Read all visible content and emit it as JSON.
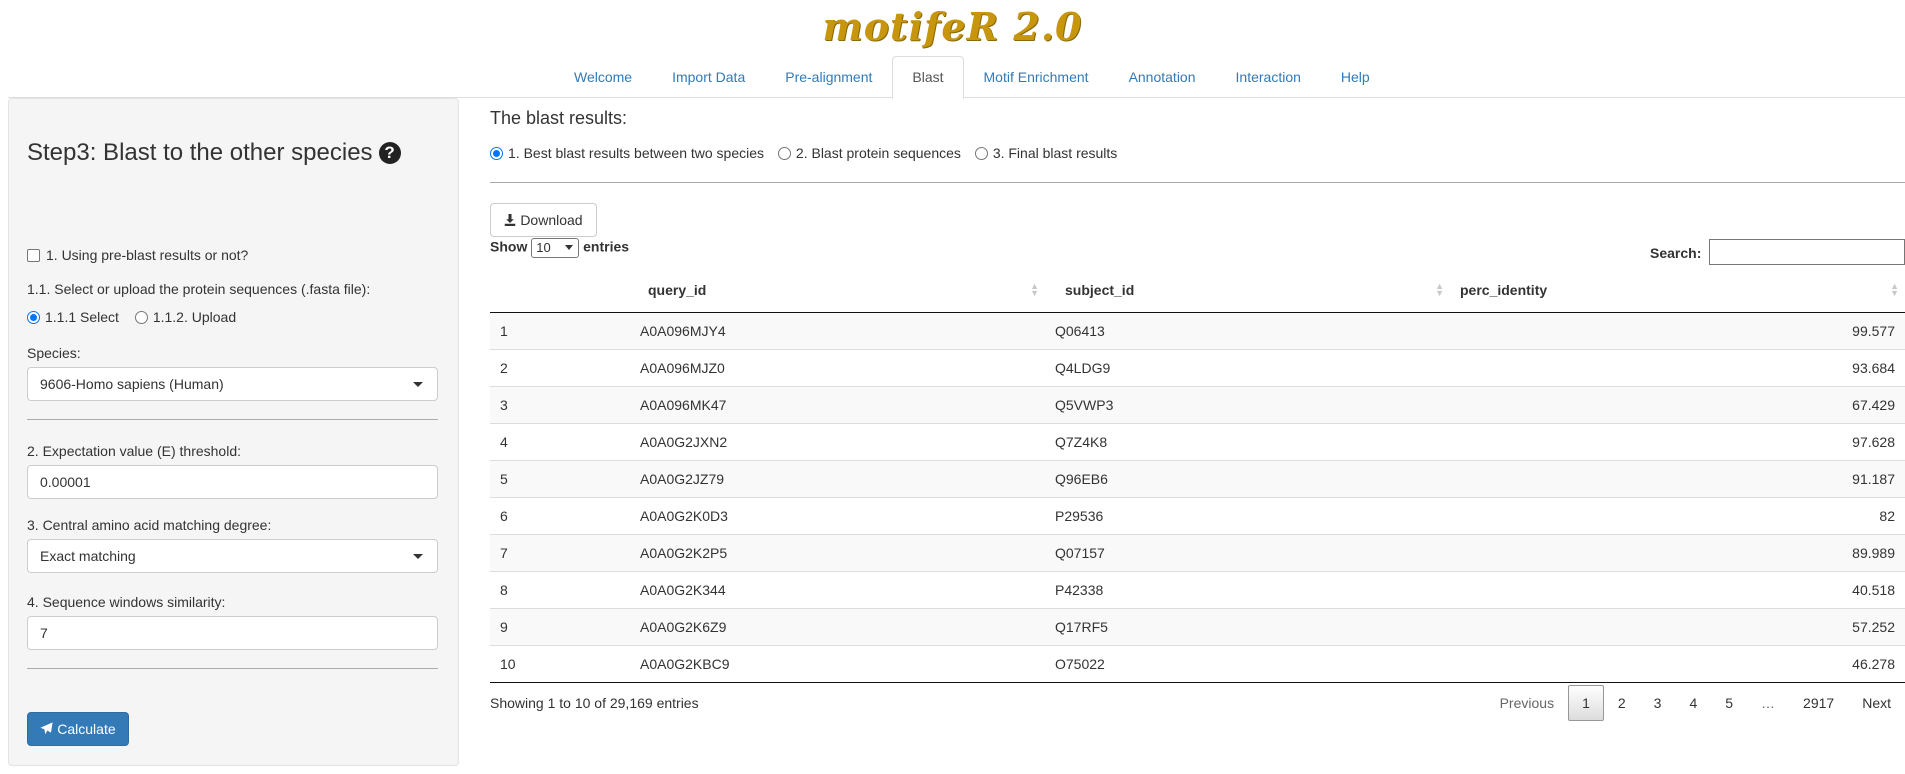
{
  "app": {
    "brand": "motifeR 2.0"
  },
  "nav": {
    "tabs": [
      "Welcome",
      "Import Data",
      "Pre-alignment",
      "Blast",
      "Motif Enrichment",
      "Annotation",
      "Interaction",
      "Help"
    ],
    "active": "Blast"
  },
  "sidebar": {
    "title": "Step3: Blast to the other species",
    "help_icon": "question-circle-icon",
    "preblast_label": "1. Using pre-blast results or not?",
    "preblast_checked": false,
    "select_upload_label": "1.1. Select or upload the protein sequences (.fasta file):",
    "option_select": "1.1.1 Select",
    "option_upload": "1.1.2. Upload",
    "species_label": "Species:",
    "species_value": "9606-Homo sapiens (Human)",
    "evalue_label": "2. Expectation value (E) threshold:",
    "evalue_value": "0.00001",
    "central_label": "3. Central amino acid matching degree:",
    "central_value": "Exact matching",
    "window_label": "4. Sequence windows similarity:",
    "window_value": "7",
    "calculate_label": "Calculate",
    "calculate_icon": "paper-plane-icon"
  },
  "main": {
    "results_title": "The blast results:",
    "result_options": [
      "1. Best blast results between two species",
      "2. Blast protein sequences",
      "3. Final blast results"
    ],
    "selected_option": 0,
    "download_label": "Download",
    "download_icon": "download-icon",
    "show_label": "Show",
    "length_value": "10",
    "entries_label": "entries",
    "search_label": "Search:",
    "table": {
      "columns": [
        "",
        "query_id",
        "subject_id",
        "perc_identity"
      ],
      "rows": [
        [
          "1",
          "A0A096MJY4",
          "Q06413",
          "99.577"
        ],
        [
          "2",
          "A0A096MJZ0",
          "Q4LDG9",
          "93.684"
        ],
        [
          "3",
          "A0A096MK47",
          "Q5VWP3",
          "67.429"
        ],
        [
          "4",
          "A0A0G2JXN2",
          "Q7Z4K8",
          "97.628"
        ],
        [
          "5",
          "A0A0G2JZ79",
          "Q96EB6",
          "91.187"
        ],
        [
          "6",
          "A0A0G2K0D3",
          "P29536",
          "82"
        ],
        [
          "7",
          "A0A0G2K2P5",
          "Q07157",
          "89.989"
        ],
        [
          "8",
          "A0A0G2K344",
          "P42338",
          "40.518"
        ],
        [
          "9",
          "A0A0G2K6Z9",
          "Q17RF5",
          "57.252"
        ],
        [
          "10",
          "A0A0G2KBC9",
          "O75022",
          "46.278"
        ]
      ]
    },
    "info_text": "Showing 1 to 10 of 29,169 entries",
    "pagination": {
      "previous": "Previous",
      "pages": [
        "1",
        "2",
        "3",
        "4",
        "5",
        "…",
        "2917"
      ],
      "current": "1",
      "next": "Next"
    }
  }
}
